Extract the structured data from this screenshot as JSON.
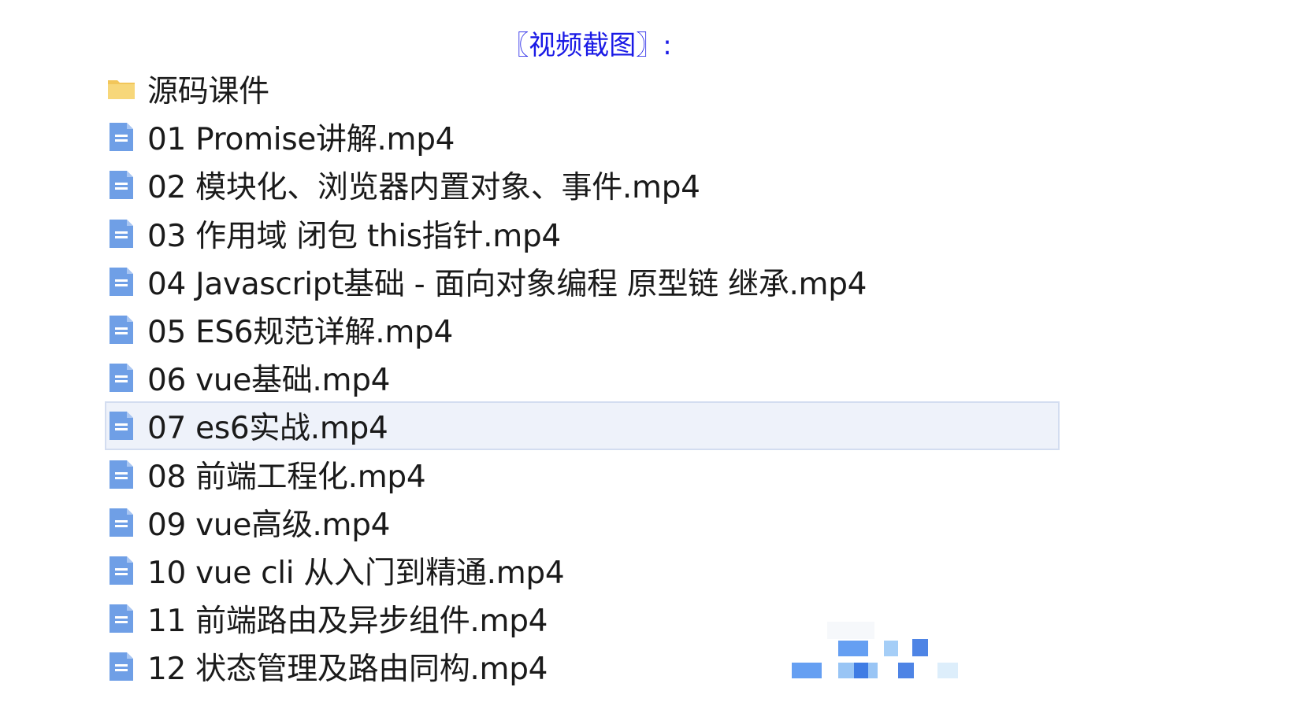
{
  "caption": "〖视频截图〗:",
  "files": [
    {
      "name": "源码课件",
      "type": "folder",
      "selected": false
    },
    {
      "name": "01 Promise讲解.mp4",
      "type": "file",
      "selected": false
    },
    {
      "name": "02 模块化、浏览器内置对象、事件.mp4",
      "type": "file",
      "selected": false
    },
    {
      "name": "03 作用域 闭包 this指针.mp4",
      "type": "file",
      "selected": false
    },
    {
      "name": "04 Javascript基础 - 面向对象编程 原型链 继承.mp4",
      "type": "file",
      "selected": false
    },
    {
      "name": "05 ES6规范详解.mp4",
      "type": "file",
      "selected": false
    },
    {
      "name": "06 vue基础.mp4",
      "type": "file",
      "selected": false
    },
    {
      "name": "07 es6实战.mp4",
      "type": "file",
      "selected": true
    },
    {
      "name": "08 前端工程化.mp4",
      "type": "file",
      "selected": false
    },
    {
      "name": "09 vue高级.mp4",
      "type": "file",
      "selected": false
    },
    {
      "name": "10 vue cli 从入门到精通.mp4",
      "type": "file",
      "selected": false
    },
    {
      "name": "11 前端路由及异步组件.mp4",
      "type": "file",
      "selected": false
    },
    {
      "name": "12 状态管理及路由同构.mp4",
      "type": "file",
      "selected": false
    }
  ],
  "icons": {
    "folder": "folder-icon",
    "file": "document-icon"
  },
  "colors": {
    "caption": "#1a1ae6",
    "folder": "#f2c65a",
    "document": "#6f9fe6",
    "selected_bg": "#eef2fa",
    "selected_border": "#d3ddf0",
    "text": "#1a1a1a"
  }
}
